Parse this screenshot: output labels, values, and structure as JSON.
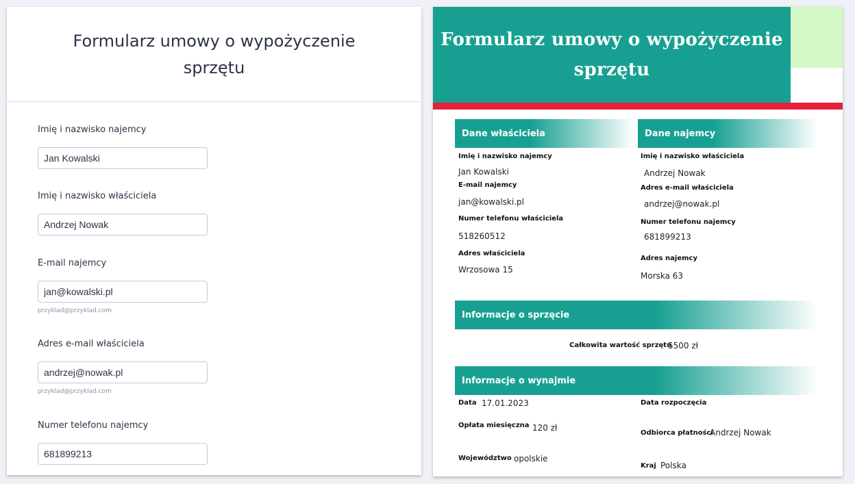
{
  "form": {
    "title": "Formularz umowy o wypożyczenie sprzętu",
    "fields": [
      {
        "label": "Imię i nazwisko najemcy",
        "value": "Jan Kowalski",
        "hint": ""
      },
      {
        "label": "Imię i nazwisko właściciela",
        "value": "Andrzej Nowak",
        "hint": ""
      },
      {
        "label": "E-mail najemcy",
        "value": "jan@kowalski.pl",
        "hint": "przyklad@przyklad.com"
      },
      {
        "label": "Adres e-mail właściciela",
        "value": "andrzej@nowak.pl",
        "hint": "przyklad@przyklad.com"
      },
      {
        "label": "Numer telefonu najemcy",
        "value": "681899213",
        "hint": ""
      }
    ]
  },
  "doc": {
    "title": "Formularz umowy o wypożyczenie sprzętu",
    "colors": {
      "teal": "#17a092",
      "green": "#d3f8c6",
      "red": "#e4203b"
    },
    "owner_section": {
      "heading": "Dane właściciela",
      "rows": [
        {
          "label": "Imię i nazwisko najemcy",
          "value": "Jan Kowalski"
        },
        {
          "label": "E-mail najemcy",
          "value": "jan@kowalski.pl"
        },
        {
          "label": "Numer telefonu właściciela",
          "value": "518260512"
        },
        {
          "label": "Adres właściciela",
          "value": "Wrzosowa 15"
        }
      ]
    },
    "renter_section": {
      "heading": "Dane najemcy",
      "rows": [
        {
          "label": "Imię i nazwisko właściciela",
          "value": "Andrzej Nowak"
        },
        {
          "label": "Adres e-mail właściciela",
          "value": "andrzej@nowak.pl"
        },
        {
          "label": "Numer telefonu najemcy",
          "value": "681899213"
        },
        {
          "label": "Adres najemcy",
          "value": "Morska 63"
        }
      ]
    },
    "equipment_section": {
      "heading": "Informacje o sprzęcie",
      "total_label": "Całkowita wartość sprzętu",
      "total_value": "5500 zł"
    },
    "rental_section": {
      "heading": "Informacje o wynajmie",
      "date_label": "Data",
      "date_value": "17.01.2023",
      "start_label": "Data rozpoczęcia",
      "fee_label": "Opłata miesięczna",
      "fee_value": "120 zł",
      "payee_label": "Odbiorca płatności",
      "payee_value": "Andrzej Nowak",
      "region_label": "Województwo",
      "region_value": "opolskie",
      "country_label": "Kraj",
      "country_value": "Polska"
    }
  }
}
